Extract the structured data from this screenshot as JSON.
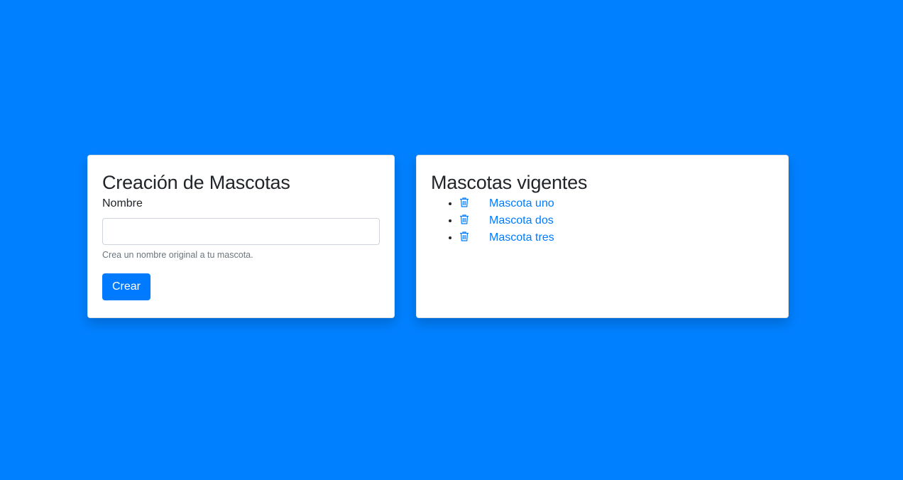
{
  "theme": {
    "background": "#0080ff",
    "accent": "#007bff",
    "link": "#007bff"
  },
  "create_card": {
    "title": "Creación de Mascotas",
    "name_label": "Nombre",
    "name_value": "",
    "name_placeholder": "",
    "help_text": "Crea un nombre original a tu mascota.",
    "submit_label": "Crear"
  },
  "list_card": {
    "title": "Mascotas vigentes",
    "items": [
      {
        "icon": "trash-icon",
        "label": "Mascota uno"
      },
      {
        "icon": "trash-icon",
        "label": "Mascota dos"
      },
      {
        "icon": "trash-icon",
        "label": "Mascota tres"
      }
    ]
  }
}
